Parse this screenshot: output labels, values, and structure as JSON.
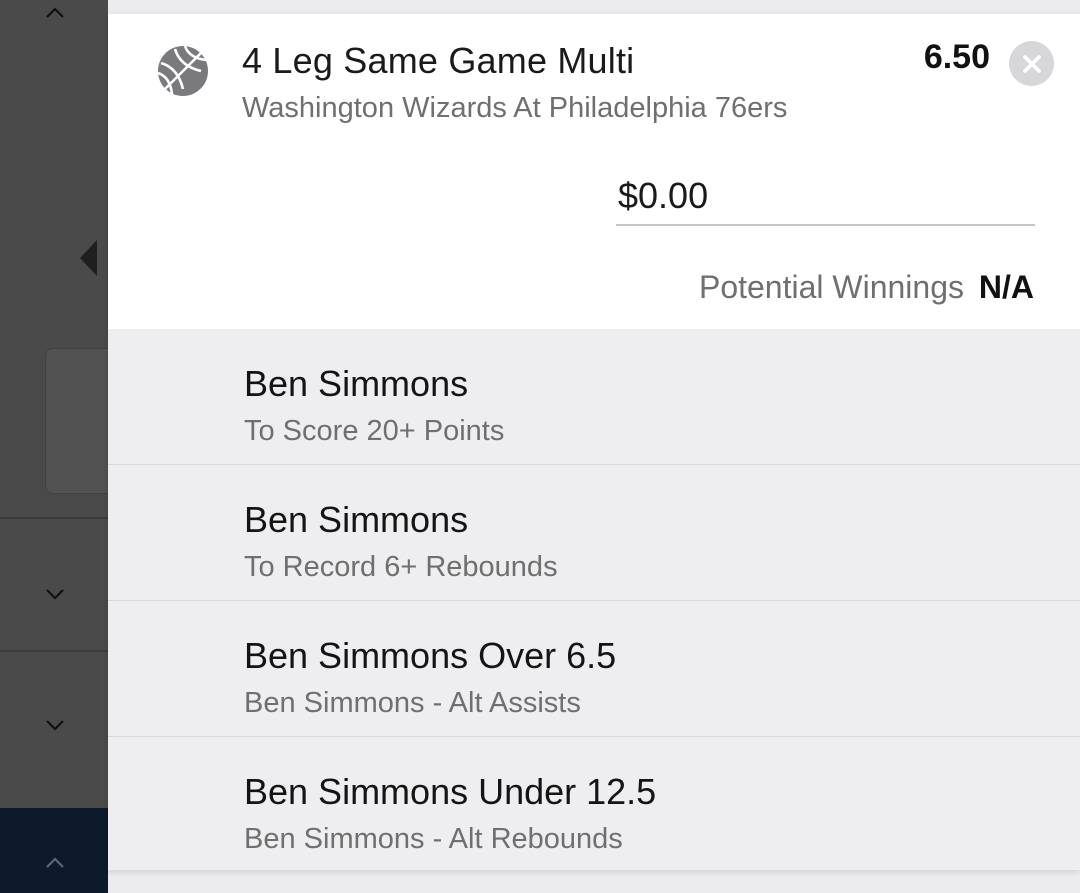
{
  "sidebar": {
    "icons": [
      "chevron-up-icon",
      "caret-left-icon",
      "chevron-down-icon",
      "chevron-down-icon",
      "chevron-up-icon"
    ]
  },
  "bet": {
    "icon": "basketball-icon",
    "title": "4 Leg Same Game Multi",
    "event": "Washington Wizards At Philadelphia 76ers",
    "odds": "6.50",
    "close_icon": "close-icon",
    "stake_value": "$0.00",
    "potential_winnings_label": "Potential Winnings",
    "potential_winnings_value": "N/A"
  },
  "legs": [
    {
      "selection": "Ben Simmons",
      "market": "To Score 20+ Points"
    },
    {
      "selection": "Ben Simmons",
      "market": "To Record 6+ Rebounds"
    },
    {
      "selection": "Ben Simmons Over 6.5",
      "market": "Ben Simmons - Alt Assists"
    },
    {
      "selection": "Ben Simmons Under 12.5",
      "market": "Ben Simmons - Alt Rebounds"
    }
  ],
  "colors": {
    "sidebar_overlay": "#4a4a4a",
    "navy_footer": "#0c1a2b",
    "leg_background": "#eeeef1",
    "muted_text": "#6f6f6f",
    "close_button": "#d7d7da"
  }
}
